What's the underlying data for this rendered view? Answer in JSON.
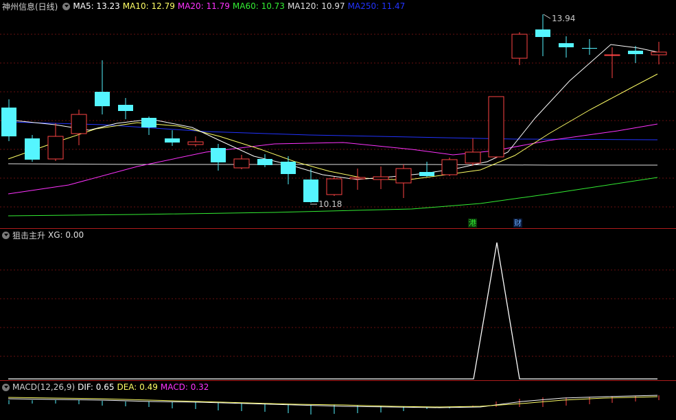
{
  "main": {
    "title": "神州信息(日线)",
    "ma_labels": [
      {
        "text": "MA5: 13.23",
        "color": "#ffffff"
      },
      {
        "text": "MA10: 12.79",
        "color": "#ffff66"
      },
      {
        "text": "MA20: 11.79",
        "color": "#ff33ff"
      },
      {
        "text": "MA60: 10.73",
        "color": "#33ee33"
      },
      {
        "text": "MA120: 10.97",
        "color": "#e0e0e0"
      },
      {
        "text": "MA250: 11.47",
        "color": "#2233ff"
      }
    ],
    "high_label": "13.94",
    "low_label": "10.18",
    "event_tags": [
      {
        "text": "港",
        "color": "#33ee33",
        "bg": "#0a3a0a"
      },
      {
        "text": "财",
        "color": "#66aaff",
        "bg": "#0a1a3a"
      }
    ]
  },
  "indicator": {
    "title": "狙击主升",
    "value_label": "XG: 0.00"
  },
  "macd": {
    "title": "MACD(12,26,9)",
    "dif_label": "DIF: 0.65",
    "dea_label": "DEA: 0.49",
    "macd_label": "MACD: 0.32",
    "colors": {
      "dif": "#ffffff",
      "dea": "#ffff66",
      "macd": "#ff33ff"
    }
  },
  "colors": {
    "up": "#ff4444",
    "down": "#55f5ff",
    "separator": "#b01c1c",
    "grid": "#7a1010"
  }
}
